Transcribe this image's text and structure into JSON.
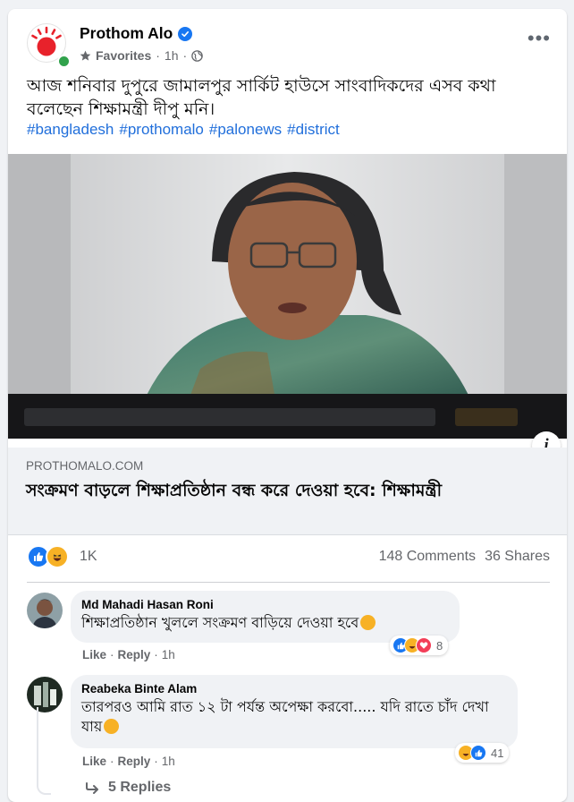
{
  "post": {
    "page_name": "Prothom Alo",
    "favorites_label": "Favorites",
    "time": "1h",
    "text": "আজ শনিবার দুপুরে জামালপুর সার্কিট হাউসে সাংবাদিকদের এসব কথা বলেছেন শিক্ষামন্ত্রী দীপু মনি।",
    "hashtags": [
      "#bangladesh",
      "#prothomalo",
      "#palonews",
      "#district"
    ]
  },
  "link_preview": {
    "domain": "PROTHOMALO.COM",
    "title": "সংক্রমণ বাড়লে শিক্ষাপ্রতিষ্ঠান বন্ধ করে দেওয়া হবে: শিক্ষামন্ত্রী",
    "info_label": "i"
  },
  "engagement": {
    "reaction_count": "1K",
    "comments": "148 Comments",
    "shares": "36 Shares"
  },
  "comments": [
    {
      "author": "Md Mahadi Hasan Roni",
      "text": "শিক্ষাপ্রতিষ্ঠান খুললে সংক্রমণ বাড়িয়ে দেওয়া হবে",
      "reaction_count": "8",
      "like_label": "Like",
      "reply_label": "Reply",
      "time": "1h"
    },
    {
      "author": "Reabeka Binte Alam",
      "text": "তারপরও আমি রাত ১২ টা পর্যন্ত অপেক্ষা করবো..... যদি রাতে চাঁদ দেখা যায়",
      "reaction_count": "41",
      "like_label": "Like",
      "reply_label": "Reply",
      "time": "1h",
      "replies_label": "5 Replies"
    }
  ],
  "colors": {
    "facebook_blue": "#1877f2",
    "hashtag_blue": "#216fdb",
    "logo_red": "#e8222b",
    "online_green": "#31a24c"
  },
  "icons": [
    "prothom-alo-logo",
    "verified-icon",
    "star-icon",
    "globe-icon",
    "more-icon",
    "info-icon",
    "like-reaction-icon",
    "haha-reaction-icon",
    "love-reaction-icon",
    "reply-arrow-icon"
  ]
}
